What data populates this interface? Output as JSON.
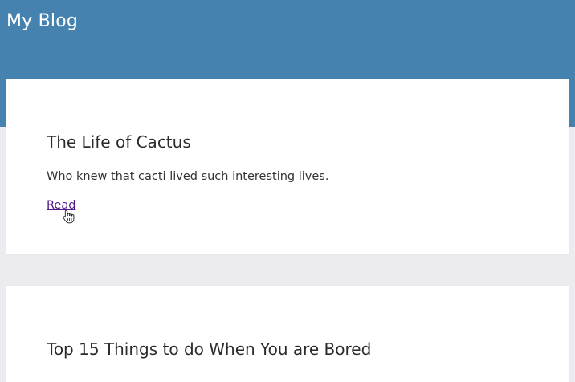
{
  "header": {
    "title": "My Blog",
    "background_color": "#4682b0"
  },
  "posts": [
    {
      "title": "The Life of Cactus",
      "excerpt": "Who knew that cacti lived such interesting lives.",
      "link_label": "Read"
    },
    {
      "title": "Top 15 Things to do When You are Bored"
    }
  ],
  "colors": {
    "page_background": "#ececf0",
    "card_background": "#ffffff",
    "link_visited": "#551a8b"
  },
  "cursor": {
    "icon": "hand-pointer-icon"
  }
}
